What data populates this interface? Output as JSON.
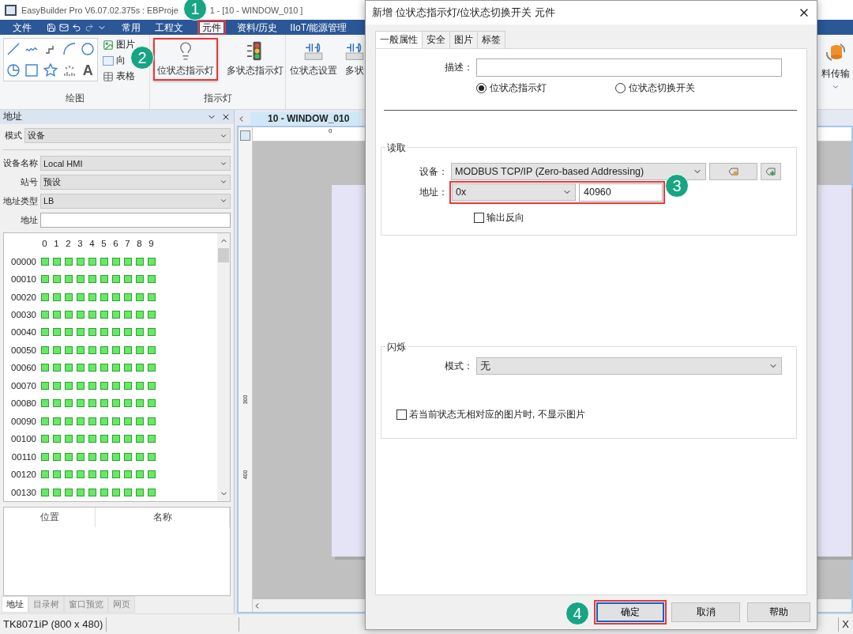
{
  "app_title": [
    "EasyBuilder Pro V6.07.02.375s : EBProje",
    "1 - [10 - WINDOW_010 ]"
  ],
  "menu": [
    {
      "label": "文件",
      "highlighted": false
    },
    {
      "label": "常用",
      "highlighted": false
    },
    {
      "label": "工程文",
      "highlighted": false
    },
    {
      "label": "元件",
      "highlighted": true
    },
    {
      "label": "资料/历史",
      "highlighted": false
    },
    {
      "label": "IIoT/能源管理",
      "highlighted": false
    }
  ],
  "ribbon": {
    "draw_group": {
      "label": "绘图",
      "text_tool": "A",
      "items": [
        "图片",
        "向",
        "表格"
      ]
    },
    "indicator_group": {
      "label": "指示灯",
      "buttons": [
        {
          "label": "位状态指示灯",
          "highlighted": true
        },
        {
          "label": "多状态指示灯",
          "highlighted": false
        }
      ]
    },
    "setting_buttons": [
      "位状态设置",
      "多状"
    ],
    "transfer": "料传输"
  },
  "address_panel": {
    "title": "地址",
    "mode": {
      "label": "模式",
      "value": "设备"
    },
    "fields": [
      {
        "label": "设备名称",
        "value": "Local HMI",
        "kind": "select"
      },
      {
        "label": "站号",
        "value": "预设",
        "kind": "select"
      },
      {
        "label": "地址类型",
        "value": "LB",
        "kind": "select"
      },
      {
        "label": "地址",
        "kind": "input"
      }
    ],
    "bit_columns": [
      "0",
      "1",
      "2",
      "3",
      "4",
      "5",
      "6",
      "7",
      "8",
      "9"
    ],
    "bit_rows": [
      "00000",
      "00010",
      "00020",
      "00030",
      "00040",
      "00050",
      "00060",
      "00070",
      "00080",
      "00090",
      "00100",
      "00110",
      "00120",
      "00130"
    ],
    "list_columns": [
      "位置",
      "名称"
    ],
    "tabs": [
      {
        "label": "地址",
        "selected": true
      },
      {
        "label": "目录树",
        "selected": false
      },
      {
        "label": "窗口预览",
        "selected": false
      },
      {
        "label": "网页",
        "selected": false
      }
    ]
  },
  "editor": {
    "tab": "10 - WINDOW_010",
    "ruler_labels": [
      "0",
      "300",
      "400"
    ]
  },
  "status_bar": [
    "TK8071iP (800 x 480)",
    "X"
  ],
  "dialog": {
    "title": "新增 位状态指示灯/位状态切换开关 元件",
    "tabs": [
      {
        "label": "一般属性",
        "selected": true
      },
      {
        "label": "安全",
        "selected": false
      },
      {
        "label": "图片",
        "selected": false
      },
      {
        "label": "标签",
        "selected": false
      }
    ],
    "description_label": "描述：",
    "radios": [
      {
        "label": "位状态指示灯",
        "selected": true
      },
      {
        "label": "位状态切换开关",
        "selected": false
      }
    ],
    "read_group": {
      "title": "读取",
      "device_label": "设备：",
      "device": "MODBUS TCP/IP (Zero-based Addressing)",
      "address_label": "地址：",
      "address_type": "0x",
      "address": "40960",
      "highlighted": true,
      "invert": {
        "label": "输出反向",
        "checked": false
      }
    },
    "blink_group": {
      "title": "闪烁",
      "mode_label": "模式：",
      "mode": "无",
      "hide_picture": {
        "label": "若当前状态无相对应的图片时, 不显示图片",
        "checked": false
      }
    },
    "buttons": [
      {
        "label": "确定",
        "highlighted": true
      },
      {
        "label": "取消",
        "highlighted": false
      },
      {
        "label": "帮助",
        "highlighted": false
      }
    ]
  },
  "badges": [
    "1",
    "2",
    "3",
    "4"
  ]
}
